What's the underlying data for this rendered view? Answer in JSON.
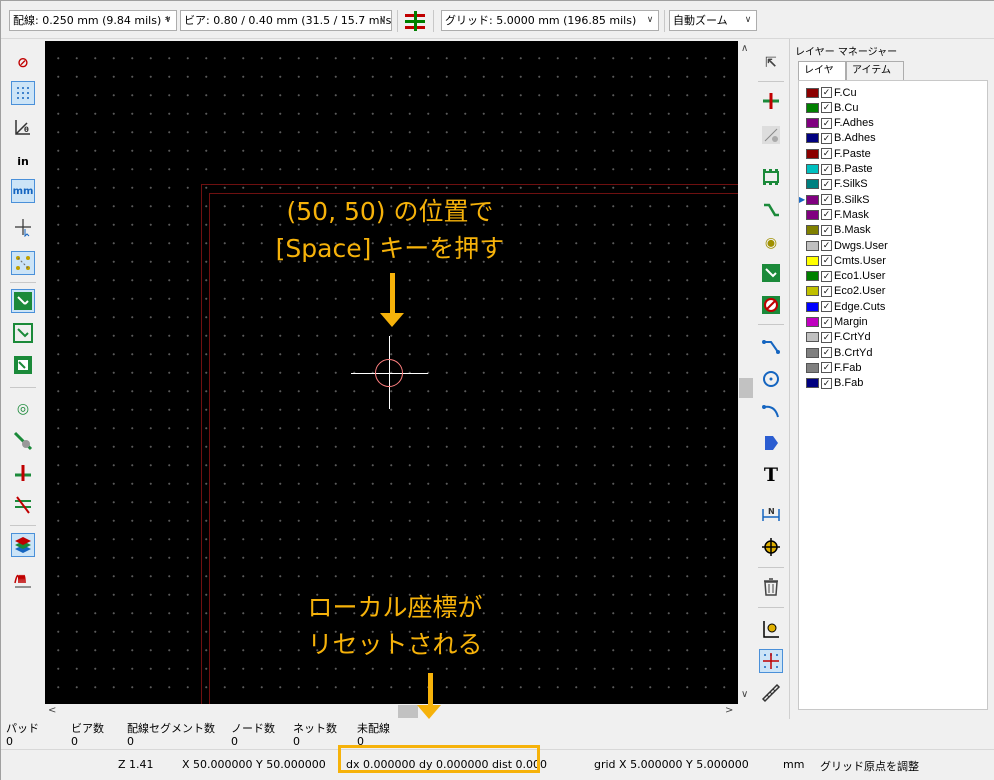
{
  "toolbar": {
    "track_width": "配線: 0.250 mm (9.84 mils) *",
    "via_size": "ビア: 0.80 / 0.40 mm (31.5 / 15.7 mils) *",
    "grid": "グリッド: 5.0000 mm (196.85 mils)",
    "zoom": "自動ズーム"
  },
  "annotations": {
    "top_line1": "(50, 50) の位置で",
    "top_line2": "[Space] キーを押す",
    "bottom_line1": "ローカル座標が",
    "bottom_line2": "リセットされる",
    "color": "#f6b20a"
  },
  "layer_manager": {
    "title": "レイヤー マネージャー",
    "tabs": [
      "レイヤー",
      "アイテム"
    ],
    "layers": [
      {
        "name": "F.Cu",
        "color": "#8b0000"
      },
      {
        "name": "B.Cu",
        "color": "#008000"
      },
      {
        "name": "F.Adhes",
        "color": "#800080"
      },
      {
        "name": "B.Adhes",
        "color": "#000080"
      },
      {
        "name": "F.Paste",
        "color": "#8b0000"
      },
      {
        "name": "B.Paste",
        "color": "#00c0c0"
      },
      {
        "name": "F.SilkS",
        "color": "#008080"
      },
      {
        "name": "B.SilkS",
        "color": "#800080"
      },
      {
        "name": "F.Mask",
        "color": "#800080"
      },
      {
        "name": "B.Mask",
        "color": "#808000"
      },
      {
        "name": "Dwgs.User",
        "color": "#c0c0c0"
      },
      {
        "name": "Cmts.User",
        "color": "#ffff00"
      },
      {
        "name": "Eco1.User",
        "color": "#008000"
      },
      {
        "name": "Eco2.User",
        "color": "#c0c000"
      },
      {
        "name": "Edge.Cuts",
        "color": "#0000ff"
      },
      {
        "name": "Margin",
        "color": "#c000c0"
      },
      {
        "name": "F.CrtYd",
        "color": "#c0c0c0"
      },
      {
        "name": "B.CrtYd",
        "color": "#808080"
      },
      {
        "name": "F.Fab",
        "color": "#808080"
      },
      {
        "name": "B.Fab",
        "color": "#000080"
      }
    ],
    "selected_layer": "B.SilkS"
  },
  "stats": {
    "pads_label": "パッド",
    "pads_value": "0",
    "vias_label": "ビア数",
    "vias_value": "0",
    "segments_label": "配線セグメント数",
    "segments_value": "0",
    "nodes_label": "ノード数",
    "nodes_value": "0",
    "nets_label": "ネット数",
    "nets_value": "0",
    "unrouted_label": "未配線",
    "unrouted_value": "0"
  },
  "statusbar": {
    "zoom": "Z 1.41",
    "xy": "X 50.000000  Y 50.000000",
    "delta": "dx 0.000000  dy 0.000000  dist 0.000",
    "grid": "grid X 5.000000  Y 5.000000",
    "units": "mm",
    "action": "グリッド原点を調整"
  }
}
